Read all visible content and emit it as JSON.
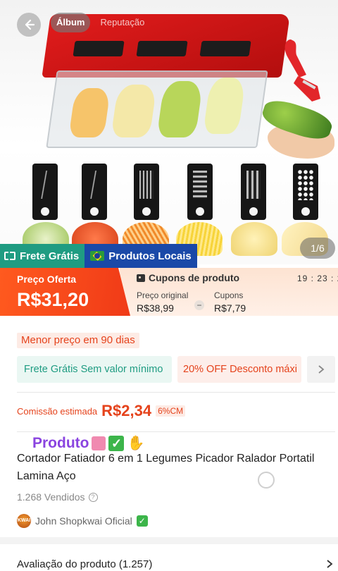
{
  "hero": {
    "tabs": [
      {
        "label": "Álbum",
        "active": true
      },
      {
        "label": "Reputação",
        "active": false
      }
    ],
    "image_counter": "1/6"
  },
  "badges": {
    "free_shipping": "Frete Grátis",
    "local_products": "Produtos Locais"
  },
  "price": {
    "offer_label": "Preço Oferta",
    "offer_value": "R$31,20",
    "coupons_title": "Cupons de produto",
    "timer": "19 : 23 : 2",
    "original_label": "Preço original",
    "original_value": "R$38,99",
    "minus_sign": "−",
    "coupons_label": "Cupons",
    "coupons_value": "R$7,79"
  },
  "info": {
    "lowest_price": "Menor preço em 90 dias",
    "promo_free": "Frete Grátis Sem valor mínimo",
    "promo_off": "20% OFF Desconto máxi",
    "commission_label": "Comissão estimada",
    "commission_value": "R$2,34",
    "commission_pct": "6%CM"
  },
  "product": {
    "tag": "Produto",
    "title": "Cortador Fatiador 6 em 1 Legumes Picador Ralador Portatil Lamina Aço",
    "sold": "1.268 Vendidos",
    "shop_name": "John Shopkwai Oficial",
    "shop_avatar_text": "KWAI"
  },
  "reviews": {
    "label": "Avaliação do produto (1.257)"
  },
  "colors": {
    "accent": "#f03a17",
    "free_shipping": "#1f9c82",
    "local": "#1a49a8",
    "produto_purple": "#8a44e0"
  },
  "icons": {
    "back": "arrow-left-icon",
    "ticket": "ticket-icon",
    "flag": "brazil-flag-icon",
    "coupon": "coupon-icon",
    "help": "question-circle-icon",
    "chevron": "chevron-right-icon"
  }
}
